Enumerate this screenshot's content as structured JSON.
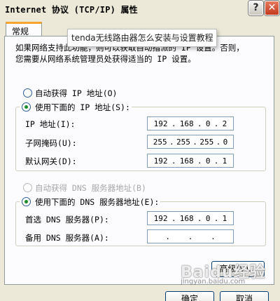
{
  "window": {
    "title": "Internet 协议 (TCP/IP) 属性",
    "help_symbol": "?",
    "close_symbol": "✕"
  },
  "tab": {
    "label": "常规"
  },
  "tooltip": {
    "text": "tenda无线路由器怎么安装与设置教程"
  },
  "info": {
    "line1": "如果网络支持此功能，则可以获取自动指派的 IP 设置。否则，",
    "line2": "您需要从网络系统管理员处获得适当的 IP 设置。"
  },
  "ip": {
    "auto_label": "自动获得 IP 地址(O)",
    "manual_label": "使用下面的 IP 地址(S):",
    "ip_label": "IP 地址(I):",
    "ip_value": [
      "192",
      "168",
      "0",
      "2"
    ],
    "mask_label": "子网掩码(U):",
    "mask_value": [
      "255",
      "255",
      "255",
      "0"
    ],
    "gateway_label": "默认网关(D):",
    "gateway_value": [
      "192",
      "168",
      "0",
      "1"
    ]
  },
  "dns": {
    "auto_label": "自动获得 DNS 服务器地址(B)",
    "manual_label": "使用下面的 DNS 服务器地址(E):",
    "preferred_label": "首选 DNS 服务器(P):",
    "preferred_value": [
      "192",
      "168",
      "0",
      "1"
    ],
    "alternate_label": "备用 DNS 服务器(A):",
    "alternate_value": [
      "",
      "",
      "",
      ""
    ]
  },
  "buttons": {
    "advanced": "高级(V)...",
    "ok": "确定",
    "cancel": "取消"
  },
  "watermark": {
    "brand": "Baidu经验",
    "url": "jingyan.baidu.com"
  }
}
